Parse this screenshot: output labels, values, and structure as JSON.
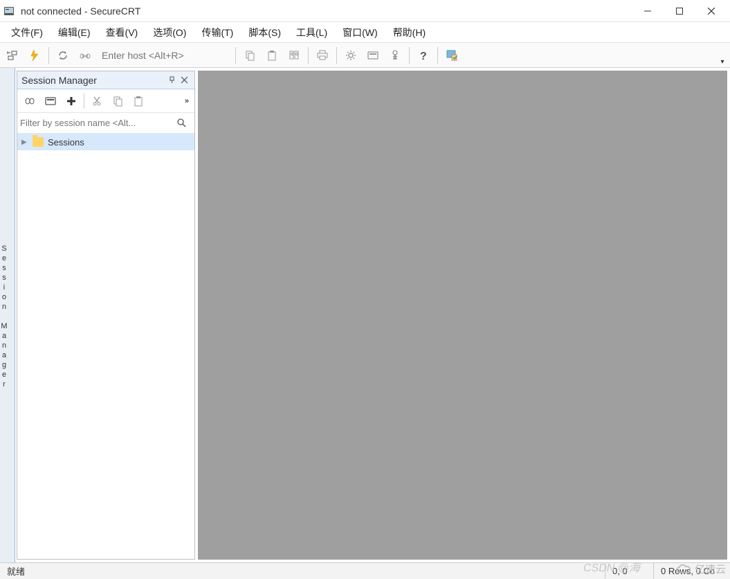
{
  "titlebar": {
    "title": "not connected - SecureCRT"
  },
  "menu": {
    "file": "文件(F)",
    "edit": "编辑(E)",
    "view": "查看(V)",
    "options": "选项(O)",
    "transfer": "传输(T)",
    "script": "脚本(S)",
    "tools": "工具(L)",
    "window": "窗口(W)",
    "help": "帮助(H)"
  },
  "toolbar": {
    "host_placeholder": "Enter host <Alt+R>"
  },
  "session_manager": {
    "title": "Session Manager",
    "filter_placeholder": "Filter by session name <Alt...",
    "root_label": "Sessions"
  },
  "statusbar": {
    "ready": "就绪",
    "cursor": "0, 0",
    "rows": "0 Rows, 0 Co"
  },
  "watermark": {
    "csdn": "CSDN @海",
    "yisu": "亿速云"
  }
}
